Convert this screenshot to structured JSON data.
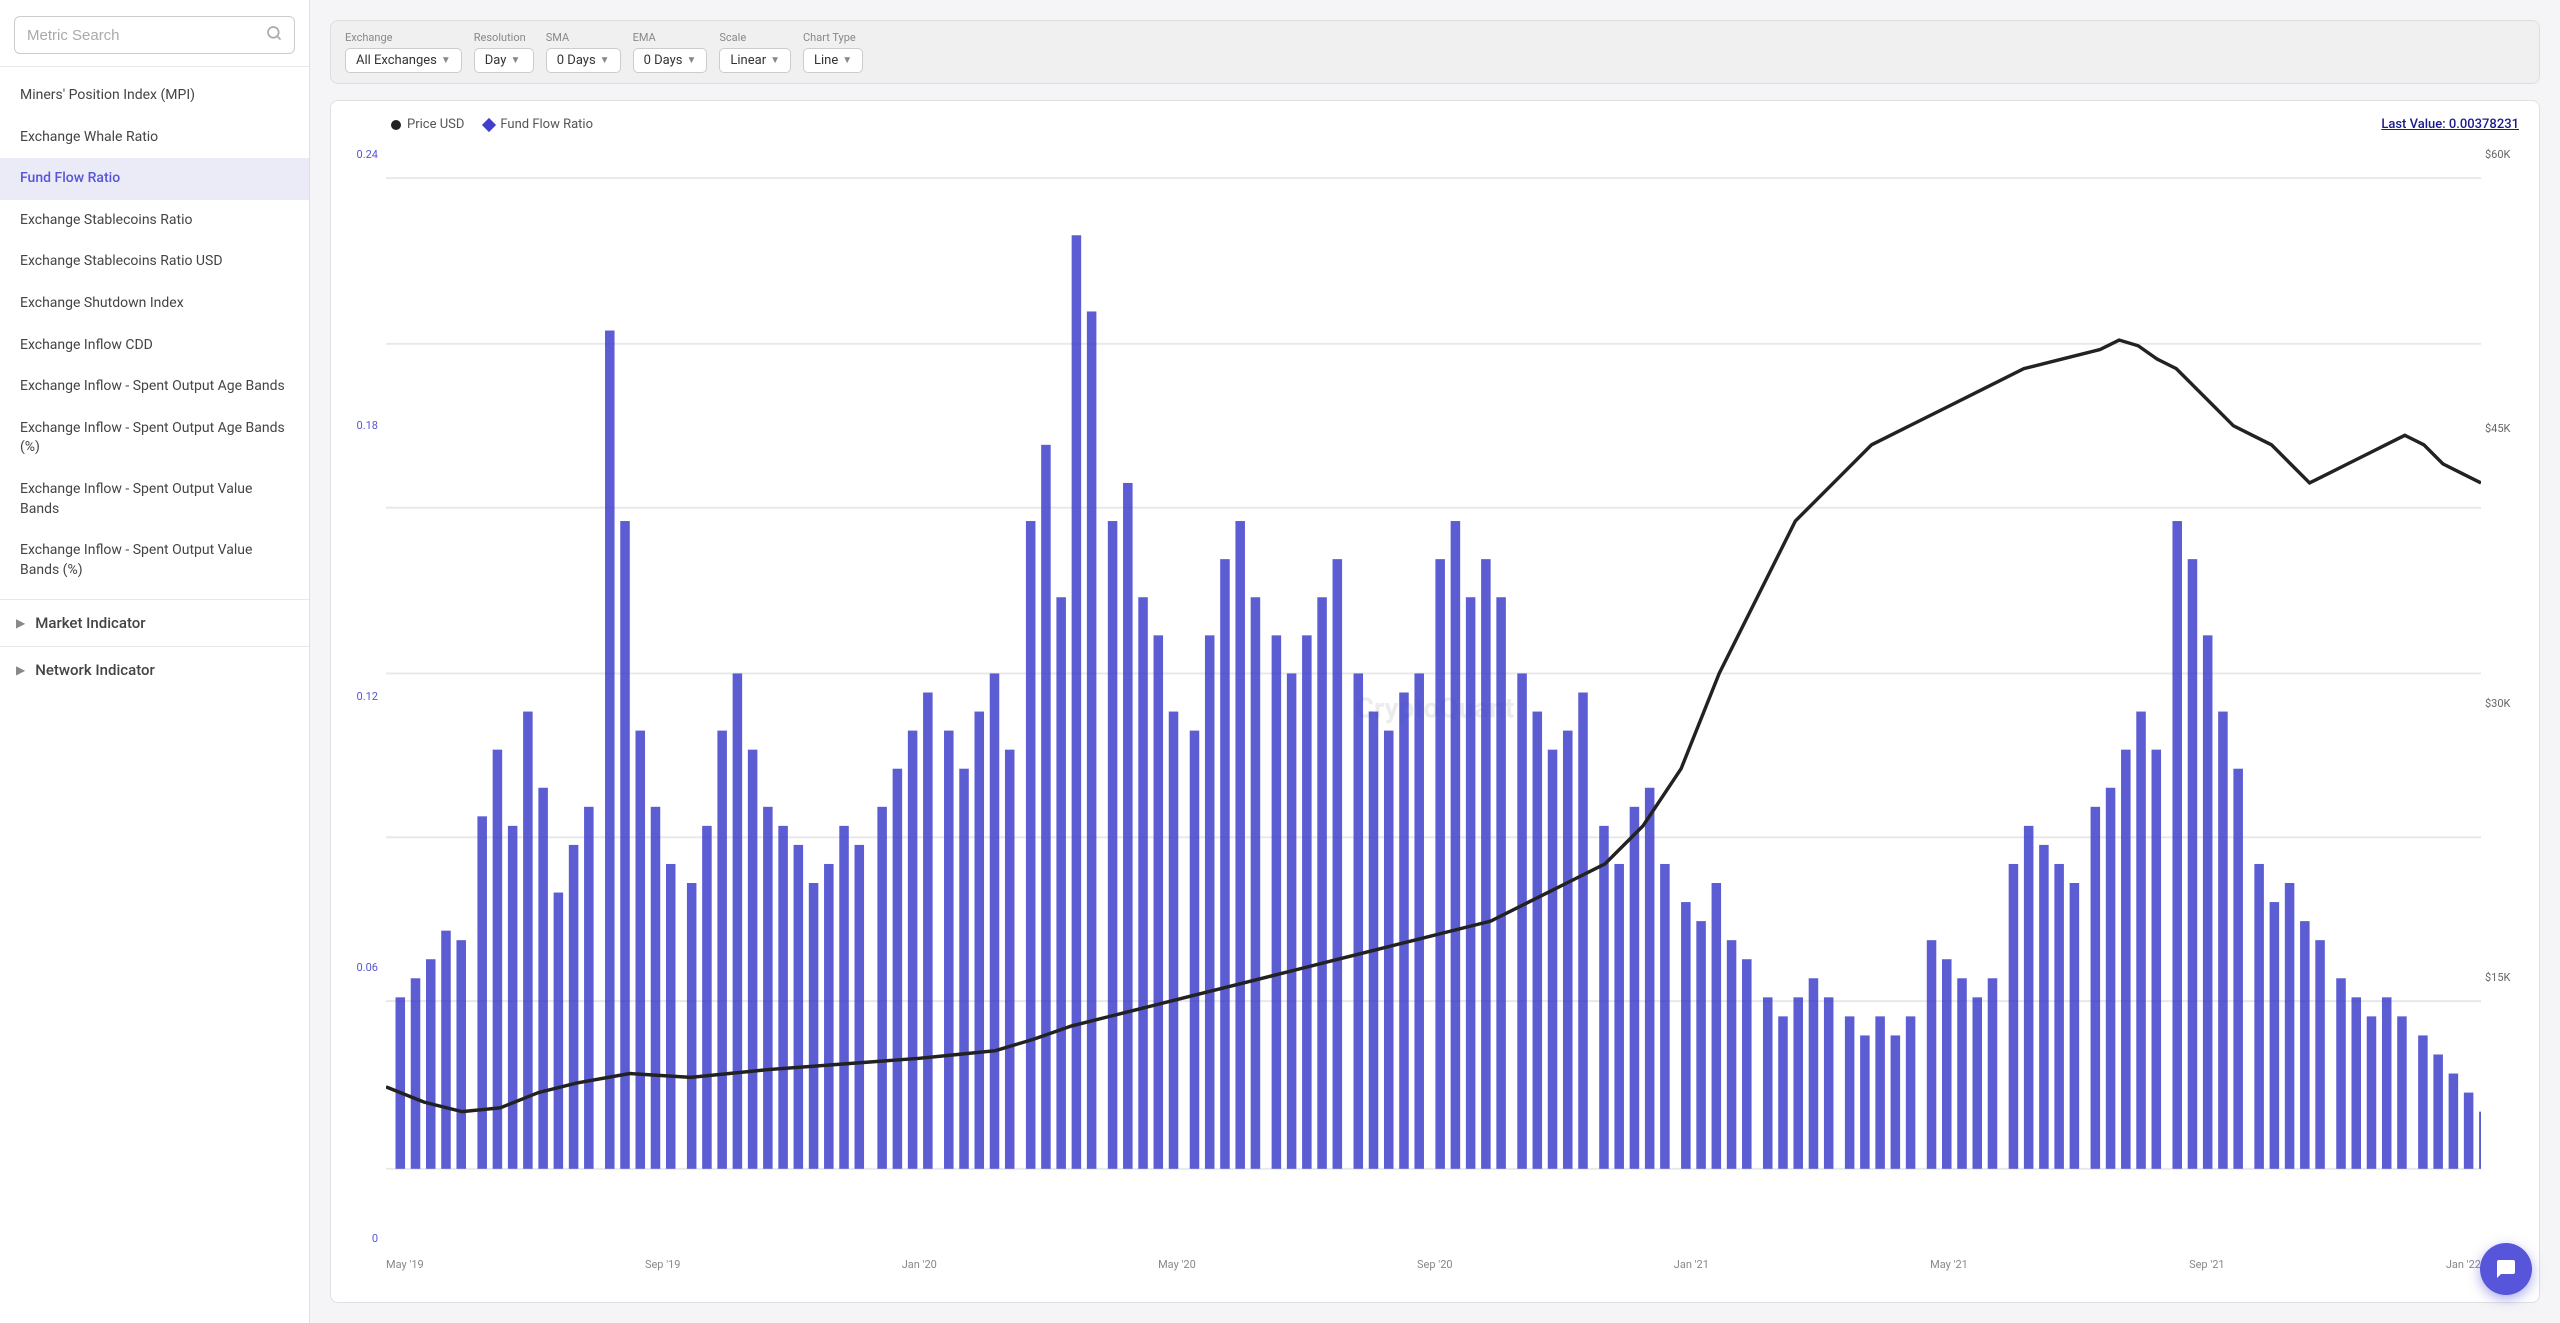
{
  "sidebar": {
    "search_placeholder": "Metric Search",
    "metrics": [
      {
        "id": "miners-position-index",
        "label": "Miners' Position Index (MPI)",
        "active": false
      },
      {
        "id": "exchange-whale-ratio",
        "label": "Exchange Whale Ratio",
        "active": false
      },
      {
        "id": "fund-flow-ratio",
        "label": "Fund Flow Ratio",
        "active": true
      },
      {
        "id": "exchange-stablecoins-ratio",
        "label": "Exchange Stablecoins Ratio",
        "active": false
      },
      {
        "id": "exchange-stablecoins-ratio-usd",
        "label": "Exchange Stablecoins Ratio USD",
        "active": false
      },
      {
        "id": "exchange-shutdown-index",
        "label": "Exchange Shutdown Index",
        "active": false
      },
      {
        "id": "exchange-inflow-cdd",
        "label": "Exchange Inflow CDD",
        "active": false
      },
      {
        "id": "exchange-inflow-soab",
        "label": "Exchange Inflow - Spent Output Age Bands",
        "active": false
      },
      {
        "id": "exchange-inflow-soab-pct",
        "label": "Exchange Inflow - Spent Output Age Bands (%)",
        "active": false
      },
      {
        "id": "exchange-inflow-sovb",
        "label": "Exchange Inflow - Spent Output Value Bands",
        "active": false
      },
      {
        "id": "exchange-inflow-sovb-pct",
        "label": "Exchange Inflow - Spent Output Value Bands (%)",
        "active": false
      }
    ],
    "sections": [
      {
        "id": "market-indicator",
        "label": "Market Indicator",
        "expanded": false
      },
      {
        "id": "network-indicator",
        "label": "Network Indicator",
        "expanded": false
      }
    ]
  },
  "toolbar": {
    "exchange_label": "Exchange",
    "exchange_value": "All Exchanges",
    "resolution_label": "Resolution",
    "resolution_value": "Day",
    "sma_label": "SMA",
    "sma_value": "0 Days",
    "ema_label": "EMA",
    "ema_value": "0 Days",
    "scale_label": "Scale",
    "scale_value": "Linear",
    "chart_type_label": "Chart Type",
    "chart_type_value": "Line"
  },
  "chart": {
    "title": "Fund Flow Ratio",
    "legend_price": "Price USD",
    "legend_ffr": "Fund Flow Ratio",
    "last_value_label": "Last Value: 0.00378231",
    "watermark": "CryptoQuant",
    "y_left_labels": [
      "0.24",
      "0.18",
      "0.12",
      "0.06",
      "0"
    ],
    "y_right_labels": [
      "$60K",
      "$45K",
      "$30K",
      "$15K",
      ""
    ],
    "x_labels": [
      "May '19",
      "Sep '19",
      "Jan '20",
      "May '20",
      "Sep '20",
      "Jan '21",
      "May '21",
      "Sep '21",
      "Jan '22"
    ]
  },
  "chat_button": {
    "aria_label": "Open chat"
  }
}
